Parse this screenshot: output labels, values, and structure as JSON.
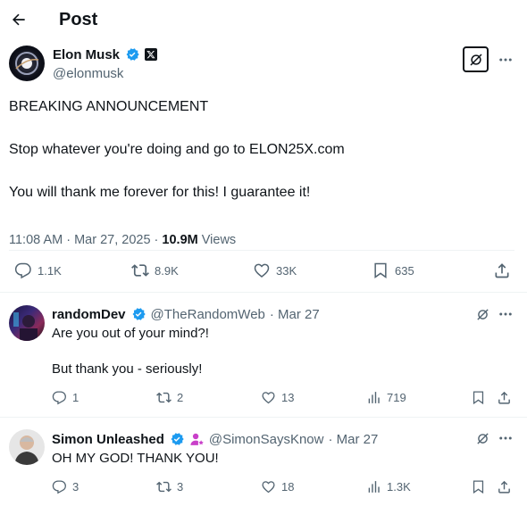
{
  "header": {
    "title": "Post"
  },
  "post": {
    "author": {
      "name": "Elon Musk",
      "handle": "@elonmusk"
    },
    "lines": [
      "BREAKING ANNOUNCEMENT",
      "Stop whatever you're doing and go to ELON25X.com",
      "You will thank me forever for this! I guarantee it!"
    ],
    "time": "11:08 AM · Mar 27, 2025 · ",
    "views_count": "10.9M",
    "views_label": " Views",
    "stats": {
      "replies": "1.1K",
      "reposts": "8.9K",
      "likes": "33K",
      "bookmarks": "635"
    }
  },
  "replies": [
    {
      "name": "randomDev",
      "handle": "@TheRandomWeb",
      "date": "· Mar 27",
      "lines": [
        "Are you out of your mind?!",
        "But thank you - seriously!"
      ],
      "stats": {
        "replies": "1",
        "reposts": "2",
        "likes": "13",
        "views": "719"
      }
    },
    {
      "name": "Simon Unleashed",
      "handle": "@SimonSaysKnow",
      "date": "· Mar 27",
      "lines": [
        "OH MY GOD! THANK YOU!"
      ],
      "stats": {
        "replies": "3",
        "reposts": "3",
        "likes": "18",
        "views": "1.3K"
      }
    }
  ],
  "colors": {
    "verified": "#1d9bf0",
    "text": "#0f1419",
    "muted": "#536471",
    "divider": "#eff3f4",
    "affiliate": "#c940c9"
  }
}
